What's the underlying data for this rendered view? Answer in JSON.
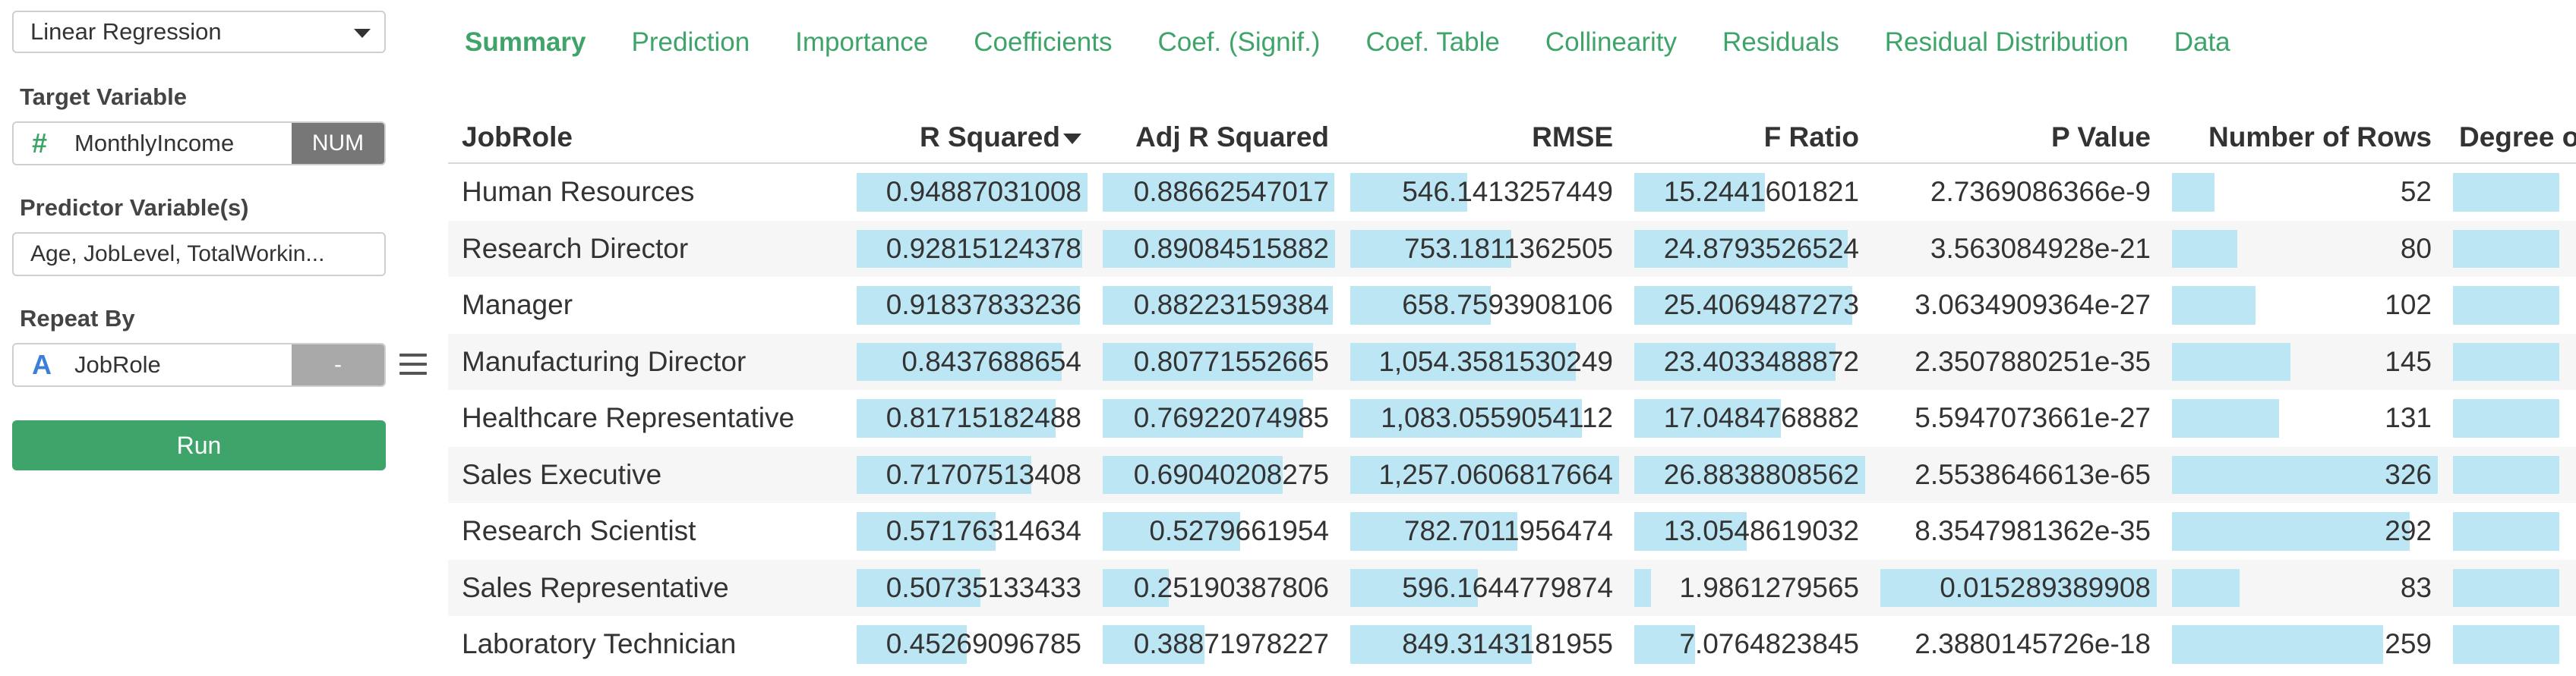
{
  "model_select": {
    "value": "Linear Regression"
  },
  "target": {
    "label": "Target Variable",
    "type_icon": "#",
    "name": "MonthlyIncome",
    "badge": "NUM"
  },
  "predictors": {
    "label": "Predictor Variable(s)",
    "value": "Age, JobLevel, TotalWorkin..."
  },
  "repeat_by": {
    "label": "Repeat By",
    "type_icon": "A",
    "name": "JobRole",
    "badge": "-"
  },
  "run_label": "Run",
  "colors": {
    "accent": "#3ea46a",
    "bar": "#bde6f5"
  },
  "tabs": [
    {
      "label": "Summary",
      "active": true
    },
    {
      "label": "Prediction"
    },
    {
      "label": "Importance"
    },
    {
      "label": "Coefficients"
    },
    {
      "label": "Coef. (Signif.)"
    },
    {
      "label": "Coef. Table"
    },
    {
      "label": "Collinearity"
    },
    {
      "label": "Residuals"
    },
    {
      "label": "Residual Distribution"
    },
    {
      "label": "Data"
    }
  ],
  "table": {
    "columns": [
      "JobRole",
      "R Squared",
      "Adj R Squared",
      "RMSE",
      "F Ratio",
      "P Value",
      "Number of Rows",
      "Degree of Freedom"
    ],
    "sorted_column": "R Squared",
    "rows": [
      {
        "job": "Human Resources",
        "r2": "0.94887031008",
        "adj": "0.88662547017",
        "rmse": "546.1413257449",
        "f": "15.2441601821",
        "p": "2.7369086366e-9",
        "n": "52"
      },
      {
        "job": "Research Director",
        "r2": "0.92815124378",
        "adj": "0.89084515882",
        "rmse": "753.1811362505",
        "f": "24.8793526524",
        "p": "3.563084928e-21",
        "n": "80"
      },
      {
        "job": "Manager",
        "r2": "0.91837833236",
        "adj": "0.88223159384",
        "rmse": "658.7593908106",
        "f": "25.4069487273",
        "p": "3.0634909364e-27",
        "n": "102"
      },
      {
        "job": "Manufacturing Director",
        "r2": "0.8437688654",
        "adj": "0.80771552665",
        "rmse": "1,054.3581530249",
        "f": "23.4033488872",
        "p": "2.3507880251e-35",
        "n": "145"
      },
      {
        "job": "Healthcare Representative",
        "r2": "0.81715182488",
        "adj": "0.76922074985",
        "rmse": "1,083.0559054112",
        "f": "17.0484768882",
        "p": "5.5947073661e-27",
        "n": "131"
      },
      {
        "job": "Sales Executive",
        "r2": "0.71707513408",
        "adj": "0.69040208275",
        "rmse": "1,257.0606817664",
        "f": "26.8838808562",
        "p": "2.5538646613e-65",
        "n": "326"
      },
      {
        "job": "Research Scientist",
        "r2": "0.57176314634",
        "adj": "0.5279661954",
        "rmse": "782.7011956474",
        "f": "13.0548619032",
        "p": "8.3547981362e-35",
        "n": "292"
      },
      {
        "job": "Sales Representative",
        "r2": "0.50735133433",
        "adj": "0.25190387806",
        "rmse": "596.1644779874",
        "f": "1.9861279565",
        "p": "0.015289389908",
        "n": "83"
      },
      {
        "job": "Laboratory Technician",
        "r2": "0.45269096785",
        "adj": "0.38871978227",
        "rmse": "849.3143181955",
        "f": "7.0764823845",
        "p": "2.3880145726e-18",
        "n": "259"
      }
    ]
  }
}
